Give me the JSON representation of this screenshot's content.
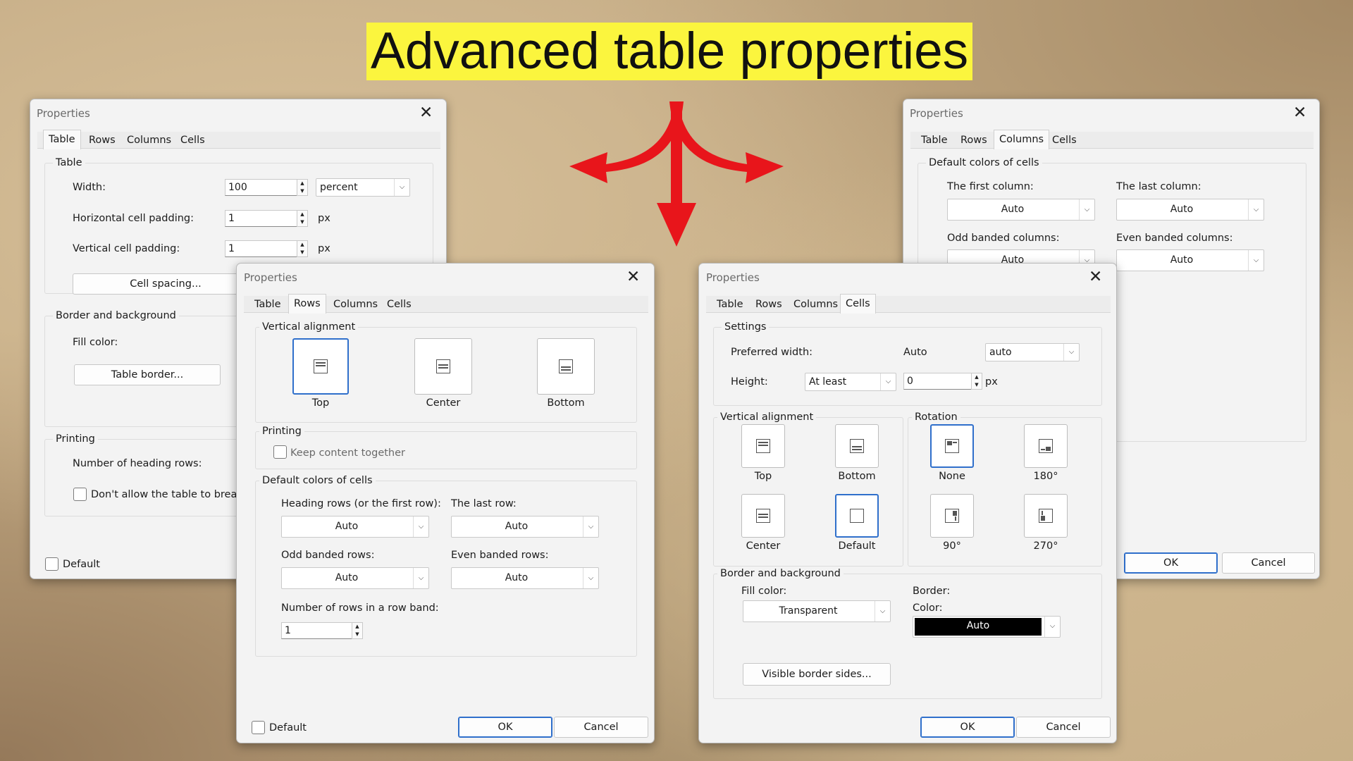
{
  "title": "Advanced table properties",
  "colors": {
    "title_bg": "#fbf53e",
    "arrow": "#e8151b",
    "accent": "#2f6fcb"
  },
  "dialogs": {
    "table": {
      "title": "Properties",
      "tabs": [
        "Table",
        "Rows",
        "Columns",
        "Cells"
      ],
      "active_tab": "Table",
      "group_table": "Table",
      "width_label": "Width:",
      "width_value": "100",
      "width_unit": "percent",
      "hpad_label": "Horizontal cell padding:",
      "hpad_value": "1",
      "vpad_label": "Vertical cell padding:",
      "vpad_value": "1",
      "px": "px",
      "cell_spacing_button": "Cell spacing...",
      "group_border": "Border and background",
      "fill_color_label": "Fill color:",
      "table_border_button": "Table border...",
      "group_printing": "Printing",
      "heading_rows_label": "Number of heading rows:",
      "dont_break_label": "Don't allow the table to break ac",
      "default_label": "Default"
    },
    "columns": {
      "title": "Properties",
      "tabs": [
        "Table",
        "Rows",
        "Columns",
        "Cells"
      ],
      "active_tab": "Columns",
      "group": "Default colors of cells",
      "first_col_label": "The first column:",
      "first_col_value": "Auto",
      "last_col_label": "The last column:",
      "last_col_value": "Auto",
      "odd_label": "Odd banded columns:",
      "odd_value": "Auto",
      "even_label": "Even banded columns:",
      "even_value": "Auto",
      "ok": "OK",
      "cancel": "Cancel"
    },
    "rows": {
      "title": "Properties",
      "tabs": [
        "Table",
        "Rows",
        "Columns",
        "Cells"
      ],
      "active_tab": "Rows",
      "group_valign": "Vertical alignment",
      "valign_options": [
        "Top",
        "Center",
        "Bottom"
      ],
      "valign_selected": "Top",
      "group_printing": "Printing",
      "keep_together": "Keep content together",
      "group_colors": "Default colors of cells",
      "heading_label": "Heading rows (or the first row):",
      "heading_value": "Auto",
      "last_row_label": "The last row:",
      "last_row_value": "Auto",
      "odd_label": "Odd banded rows:",
      "odd_value": "Auto",
      "even_label": "Even banded rows:",
      "even_value": "Auto",
      "band_label": "Number of rows in a row band:",
      "band_value": "1",
      "default_label": "Default",
      "ok": "OK",
      "cancel": "Cancel"
    },
    "cells": {
      "title": "Properties",
      "tabs": [
        "Table",
        "Rows",
        "Columns",
        "Cells"
      ],
      "active_tab": "Cells",
      "group_settings": "Settings",
      "pref_width_label": "Preferred width:",
      "pref_width_value": "Auto",
      "pref_width_unit": "auto",
      "height_label": "Height:",
      "height_mode": "At least",
      "height_value": "0",
      "px": "px",
      "group_valign": "Vertical alignment",
      "valign_options": [
        "Top",
        "Bottom",
        "Center",
        "Default"
      ],
      "valign_selected": "Default",
      "group_rotation": "Rotation",
      "rotation_options": [
        "None",
        "180°",
        "90°",
        "270°"
      ],
      "rotation_selected": "None",
      "group_border": "Border and background",
      "fill_color_label": "Fill color:",
      "fill_color_value": "Transparent",
      "border_label": "Border:",
      "color_label": "Color:",
      "color_value": "Auto",
      "visible_border_button": "Visible border sides...",
      "ok": "OK",
      "cancel": "Cancel"
    }
  }
}
